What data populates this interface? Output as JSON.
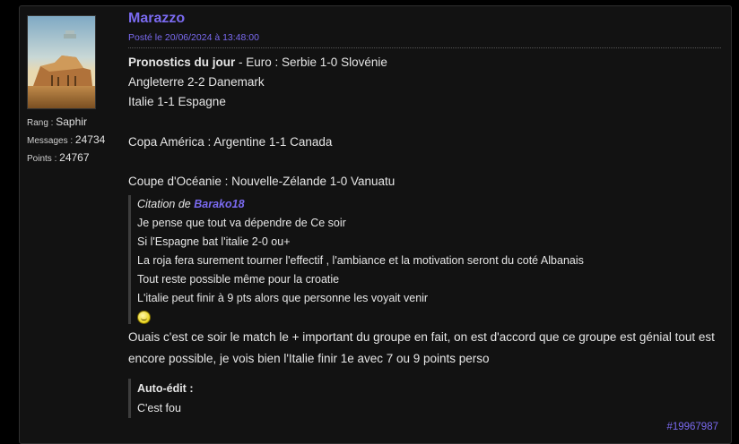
{
  "post": {
    "author": "Marazzo",
    "date": "Posté le 20/06/2024 à 13:48:00",
    "rank_label": "Rang",
    "rank_value": "Saphir",
    "messages_label": "Messages",
    "messages_value": "24734",
    "points_label": "Points",
    "points_value": "24767",
    "intro_bold": "Pronostics du jour",
    "intro_rest": " - Euro : Serbie 1-0 Slovénie",
    "lines": [
      "Angleterre 2-2 Danemark",
      "Italie 1-1 Espagne",
      "Copa América : Argentine 1-1 Canada",
      "Coupe d'Océanie : Nouvelle-Zélande 1-0 Vanuatu"
    ],
    "quote": {
      "prefix": "Citation de ",
      "author": "Barako18",
      "lines": [
        "Je pense que tout va dépendre de Ce soir",
        "Si l'Espagne bat l'italie 2-0 ou+",
        "La roja fera surement tourner l'effectif , l'ambiance et la motivation seront du coté Albanais",
        "Tout reste possible même pour la croatie",
        "L'italie peut finir à 9 pts alors que personne les voyait venir"
      ],
      "smiley": "smiley-icon"
    },
    "reply": "Ouais c'est ce soir le match le + important du groupe en fait, on est d'accord que ce groupe est génial tout est encore possible, je vois bien l'Italie finir 1e avec 7 ou 9 points perso",
    "autoedit": {
      "title": "Auto-édit :",
      "text": "C'est fou"
    },
    "post_id": "#19967987"
  },
  "colors": {
    "accent": "#7a6af0",
    "background": "#000000",
    "panel": "#121212"
  }
}
